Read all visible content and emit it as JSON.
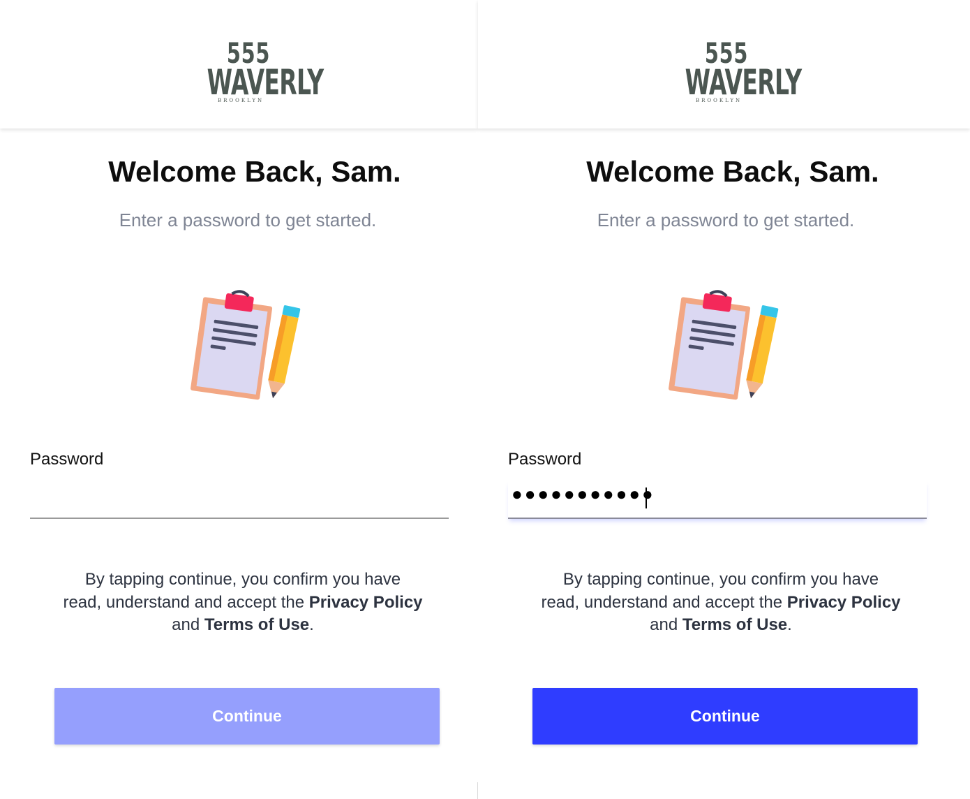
{
  "brand": {
    "logo_top": "555",
    "logo_main": "WAVERLY",
    "logo_sub": "BROOKLYN",
    "color": "#4b5651"
  },
  "welcome": {
    "title": "Welcome Back, Sam.",
    "subtitle": "Enter a password to get started."
  },
  "illustration": {
    "icon": "clipboard-pencil-icon"
  },
  "password": {
    "label": "Password",
    "left_value": "",
    "right_value": "●●●●●●●●●●●"
  },
  "legal": {
    "line1": "By tapping continue, you confirm you have",
    "line2_prefix": "read, understand and accept the ",
    "privacy": "Privacy Policy",
    "and": "and ",
    "terms": "Terms of Use",
    "period": "."
  },
  "button": {
    "label": "Continue",
    "disabled_color": "#959ffd",
    "enabled_color": "#2f3dff"
  }
}
